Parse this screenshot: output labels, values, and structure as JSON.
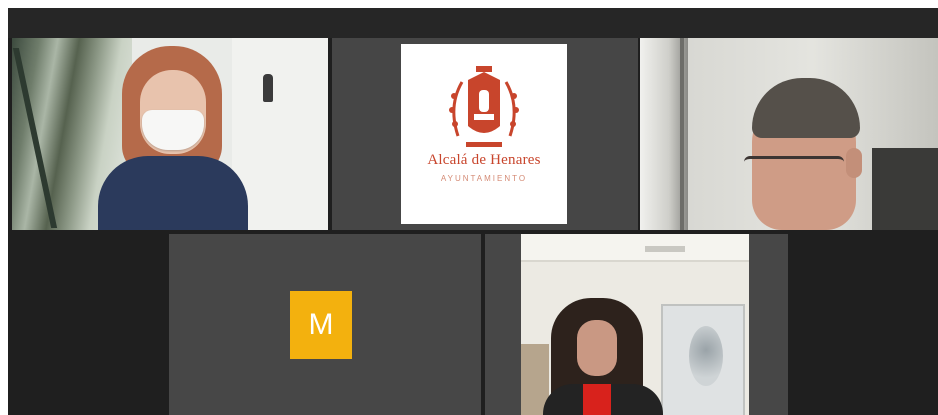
{
  "app": {
    "type": "video-conference-gallery-view"
  },
  "participants": [
    {
      "id": "p1",
      "kind": "video",
      "description": "woman-with-mask"
    },
    {
      "id": "p2",
      "kind": "logo",
      "logo_title": "Alcalá de Henares",
      "logo_subtitle": "AYUNTAMIENTO"
    },
    {
      "id": "p3",
      "kind": "video",
      "description": "man-with-glasses"
    },
    {
      "id": "p4",
      "kind": "avatar",
      "initial": "M",
      "avatar_color": "#f3b10e"
    },
    {
      "id": "p5",
      "kind": "video",
      "description": "woman-in-red"
    }
  ],
  "colors": {
    "background": "#1f1f1f",
    "tile": "#464646",
    "logo_red": "#c8452c",
    "avatar": "#f3b10e"
  }
}
